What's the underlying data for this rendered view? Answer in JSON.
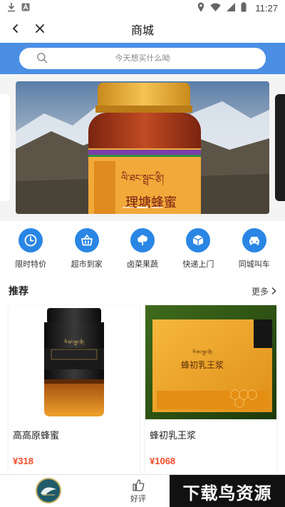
{
  "status_bar": {
    "time": "11:27"
  },
  "header": {
    "title": "商城"
  },
  "search": {
    "placeholder": "今天想买什么呦"
  },
  "banner": {
    "product_label": "理塘蜂蜜",
    "dots": 3,
    "active_dot": 1
  },
  "quick_nav": [
    {
      "label": "限时特价",
      "icon": "clock-icon"
    },
    {
      "label": "超市到家",
      "icon": "basket-icon"
    },
    {
      "label": "卤菜果蔬",
      "icon": "produce-icon"
    },
    {
      "label": "快递上门",
      "icon": "package-icon"
    },
    {
      "label": "同城叫车",
      "icon": "car-icon"
    }
  ],
  "recommend": {
    "title": "推荐",
    "more_label": "更多"
  },
  "products": [
    {
      "name": "高高原蜂蜜",
      "price": "¥318"
    },
    {
      "name": "蜂初乳王浆",
      "price": "¥1068",
      "box_text": "蜂初乳王浆"
    }
  ],
  "tabbar": {
    "review_label": "好评"
  },
  "watermark": "下载鸟资源",
  "colors": {
    "accent": "#2a86e4",
    "search_band": "#4a8fe4",
    "price": "#f44b2b"
  }
}
